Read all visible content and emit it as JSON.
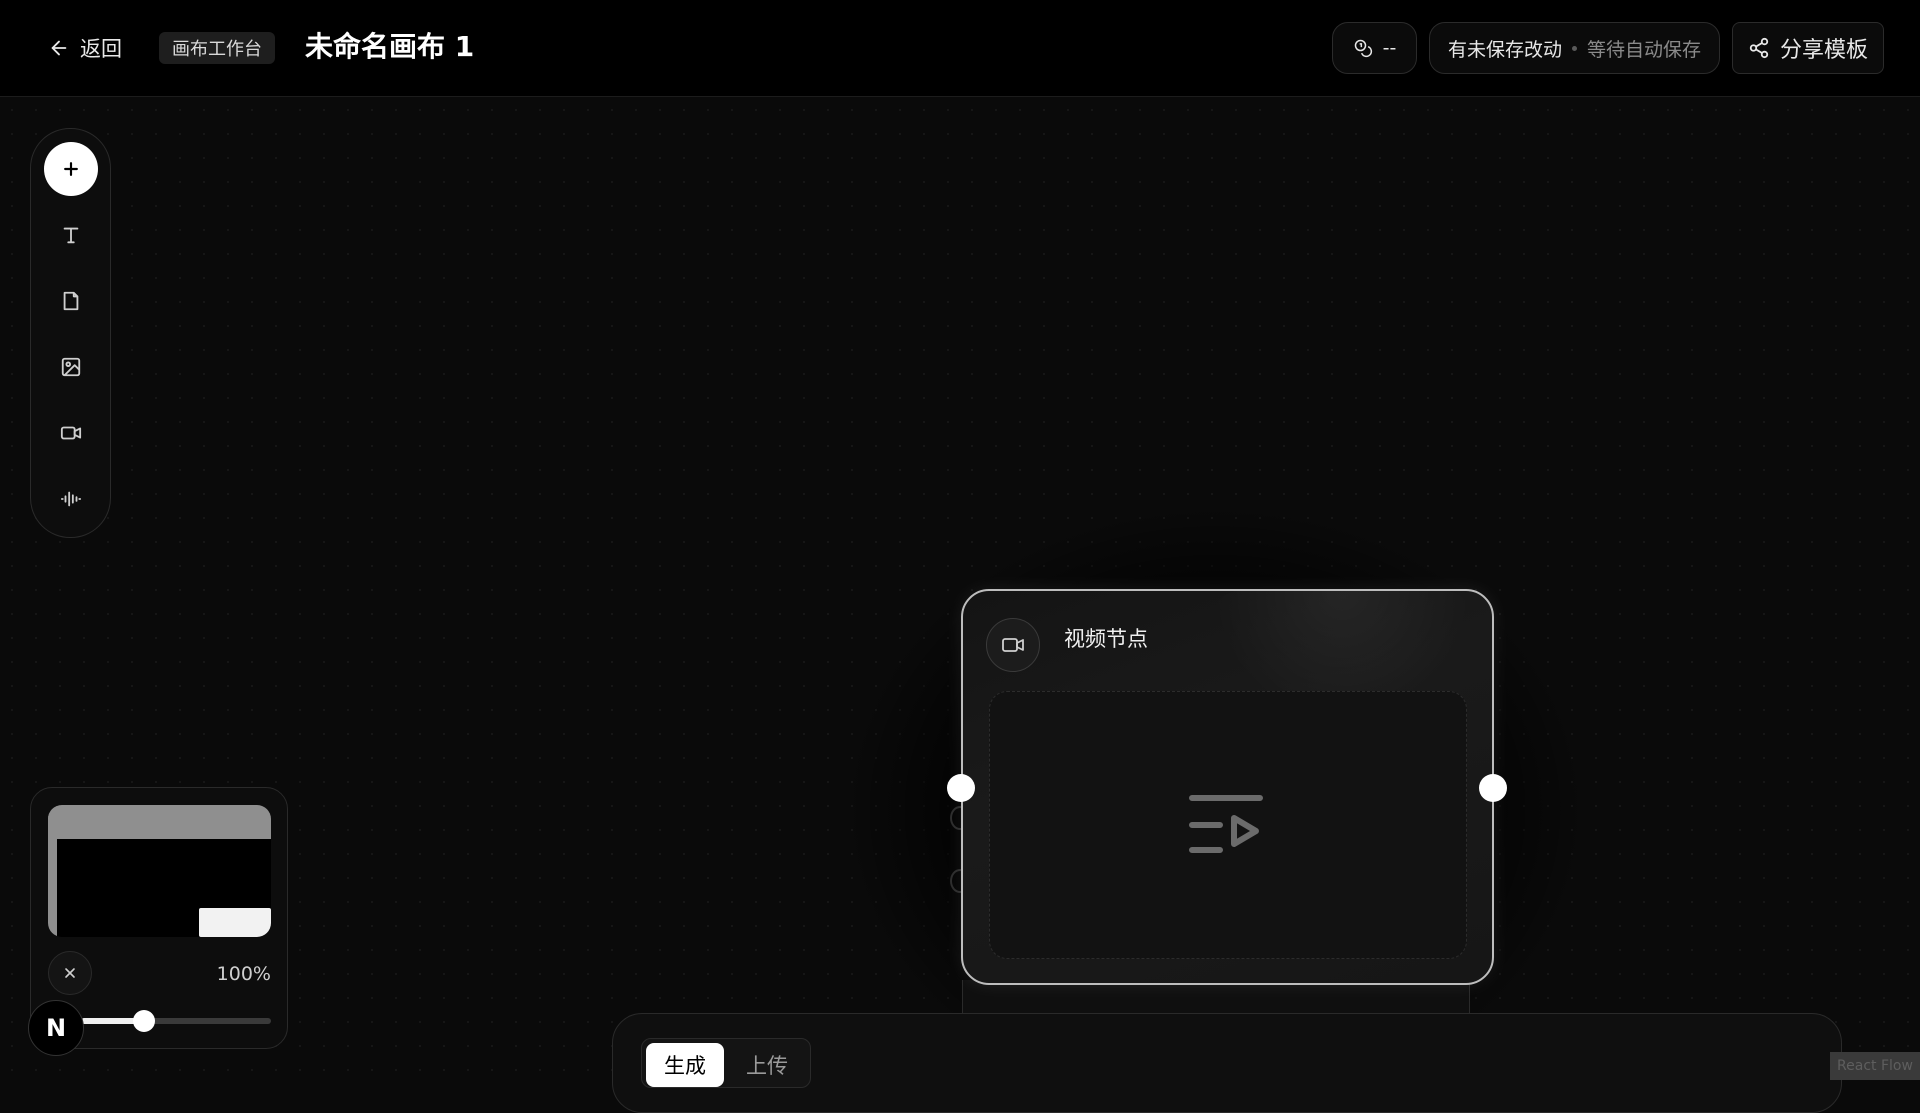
{
  "header": {
    "back_label": "返回",
    "workspace_badge": "画布工作台",
    "title": "未命名画布 1",
    "credits_value": "--",
    "save_status": "有未保存改动",
    "autosave_status": "等待自动保存",
    "share_label": "分享模板"
  },
  "toolbar": {
    "items": [
      {
        "name": "add",
        "icon": "plus-icon"
      },
      {
        "name": "text",
        "icon": "text-icon"
      },
      {
        "name": "document",
        "icon": "file-icon"
      },
      {
        "name": "image",
        "icon": "image-icon"
      },
      {
        "name": "video",
        "icon": "video-icon"
      },
      {
        "name": "audio",
        "icon": "audio-wave-icon"
      }
    ]
  },
  "video_node": {
    "title": "视频节点",
    "icon": "video-icon",
    "placeholder_icon": "playlist-play-icon"
  },
  "minimap": {
    "zoom_level": "100%",
    "zoom_slider_fraction": 0.33
  },
  "bottom_panel": {
    "tabs": [
      {
        "label": "生成",
        "active": true
      },
      {
        "label": "上传",
        "active": false
      }
    ]
  },
  "badge": {
    "letter": "N"
  },
  "attribution": "React Flow",
  "colors": {
    "background": "#0a0a0a",
    "header": "#000000",
    "accent": "#ffffff",
    "node_border": "#bdbdbd"
  }
}
